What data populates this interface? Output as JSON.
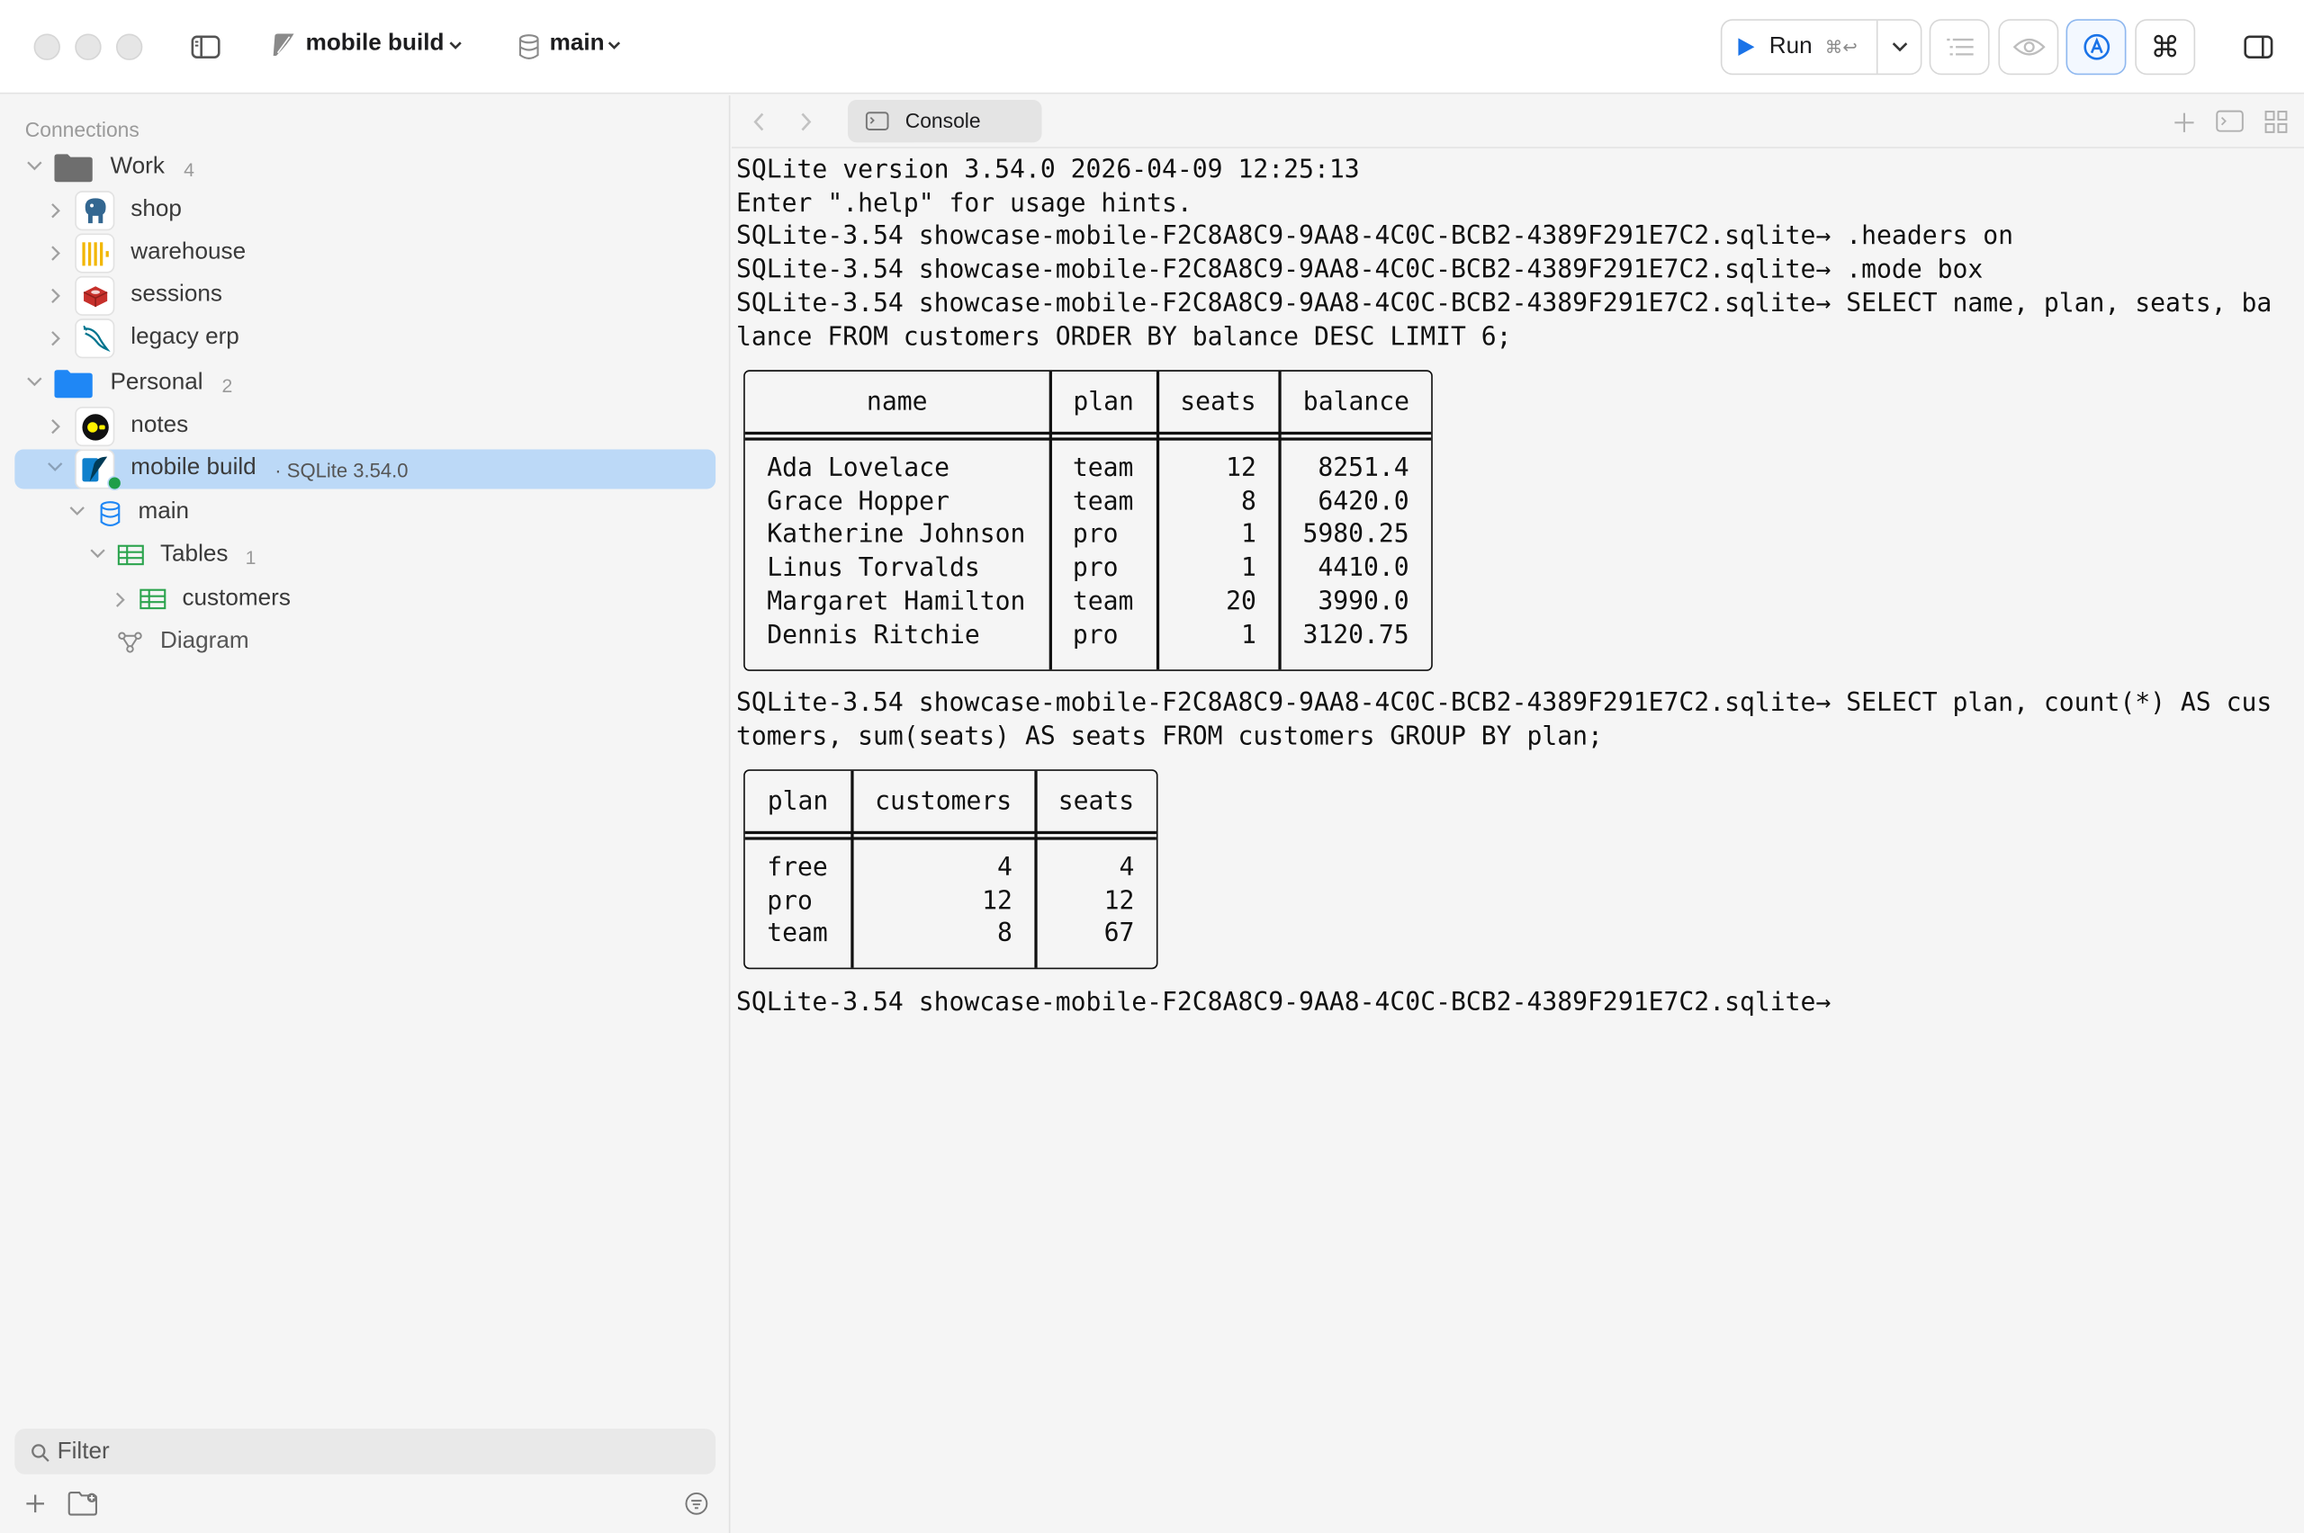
{
  "toolbar": {
    "connection_name": "mobile build",
    "schema_name": "main",
    "run_label": "Run",
    "run_shortcut": "⌘↩"
  },
  "sidebar": {
    "header": "Connections",
    "groups": [
      {
        "name": "Work",
        "count": "4",
        "items": [
          "shop",
          "warehouse",
          "sessions",
          "legacy erp"
        ]
      },
      {
        "name": "Personal",
        "count": "2",
        "items": [
          "notes",
          "mobile build"
        ]
      }
    ],
    "selected_connection": {
      "name": "mobile build",
      "meta": "· SQLite 3.54.0"
    },
    "schema": "main",
    "tables_label": "Tables",
    "tables_count": "1",
    "table_items": [
      "customers"
    ],
    "diagram_label": "Diagram",
    "filter_placeholder": "Filter"
  },
  "tabs": {
    "console_label": "Console"
  },
  "console": {
    "lines": [
      "SQLite version 3.54.0 2026-04-09 12:25:13",
      "Enter \".help\" for usage hints.",
      "SQLite-3.54 showcase-mobile-F2C8A8C9-9AA8-4C0C-BCB2-4389F291E7C2.sqlite→ .headers on",
      "SQLite-3.54 showcase-mobile-F2C8A8C9-9AA8-4C0C-BCB2-4389F291E7C2.sqlite→ .mode box",
      "SQLite-3.54 showcase-mobile-F2C8A8C9-9AA8-4C0C-BCB2-4389F291E7C2.sqlite→ SELECT name, plan, seats, ba",
      "lance FROM customers ORDER BY balance DESC LIMIT 6;"
    ],
    "query1_result": {
      "columns": [
        "name",
        "plan",
        "seats",
        "balance"
      ],
      "rows": [
        [
          "Ada Lovelace",
          "team",
          "12",
          "8251.4"
        ],
        [
          "Grace Hopper",
          "team",
          "8",
          "6420.0"
        ],
        [
          "Katherine Johnson",
          "pro",
          "1",
          "5980.25"
        ],
        [
          "Linus Torvalds",
          "pro",
          "1",
          "4410.0"
        ],
        [
          "Margaret Hamilton",
          "team",
          "20",
          "3990.0"
        ],
        [
          "Dennis Ritchie",
          "pro",
          "1",
          "3120.75"
        ]
      ]
    },
    "lines2": [
      "SQLite-3.54 showcase-mobile-F2C8A8C9-9AA8-4C0C-BCB2-4389F291E7C2.sqlite→ SELECT plan, count(*) AS cus",
      "tomers, sum(seats) AS seats FROM customers GROUP BY plan;"
    ],
    "query2_result": {
      "columns": [
        "plan",
        "customers",
        "seats"
      ],
      "rows": [
        [
          "free",
          "4",
          "4"
        ],
        [
          "pro",
          "12",
          "12"
        ],
        [
          "team",
          "8",
          "67"
        ]
      ]
    },
    "prompt": "SQLite-3.54 showcase-mobile-F2C8A8C9-9AA8-4C0C-BCB2-4389F291E7C2.sqlite→"
  },
  "colors": {
    "accent": "#1a73e8",
    "selection": "#bcd9f7",
    "folder_work": "#6e6e6e",
    "folder_personal": "#1f87f5",
    "status_online": "#1e9e4a"
  },
  "icons": {
    "shop": "postgres-elephant-icon",
    "warehouse": "clickhouse-bars-icon",
    "sessions": "redis-cube-icon",
    "legacy_erp": "mysql-dolphin-icon",
    "notes": "duckdb-icon",
    "mobile_build": "sqlite-feather-icon"
  }
}
